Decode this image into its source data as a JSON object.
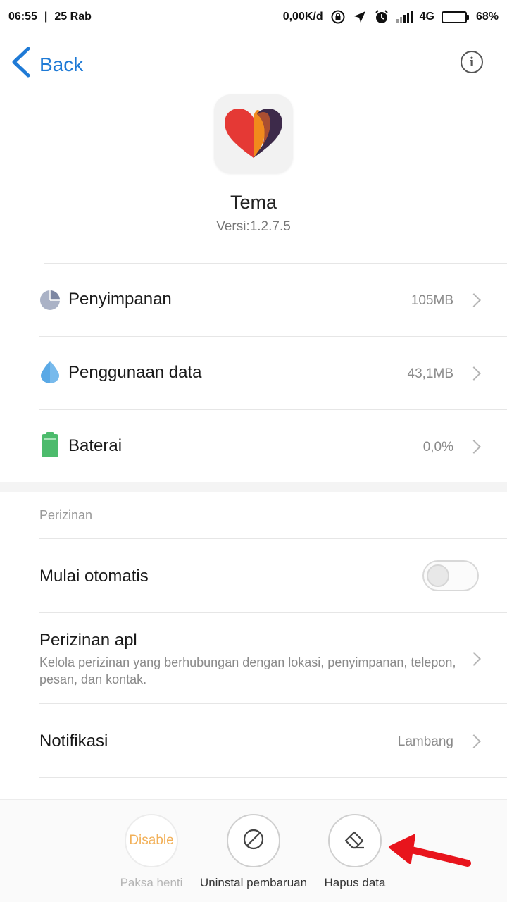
{
  "status_bar": {
    "time": "06:55",
    "separator": "|",
    "date": "25 Rab",
    "net_speed": "0,00K/d",
    "network_type": "4G",
    "battery_percent": "68%",
    "battery_level": 0.68,
    "icons": [
      "rotation-lock-icon",
      "location-arrow-icon",
      "alarm-clock-icon",
      "signal-icon",
      "battery-icon"
    ]
  },
  "nav": {
    "back_label": "Back",
    "info_glyph": "i"
  },
  "app": {
    "name": "Tema",
    "version": "Versi:1.2.7.5",
    "icon": "heart-themes-icon"
  },
  "rows": [
    {
      "label": "Penyimpanan",
      "value": "105MB",
      "icon": "pie-chart-icon",
      "color": "#8f99b3"
    },
    {
      "label": "Penggunaan data",
      "value": "43,1MB",
      "icon": "water-drop-icon",
      "color": "#5aa9e6"
    },
    {
      "label": "Baterai",
      "value": "0,0%",
      "icon": "battery-green-icon",
      "color": "#4cbb6c"
    }
  ],
  "permissions": {
    "section_label": "Perizinan",
    "autostart_label": "Mulai otomatis",
    "autostart_enabled": false,
    "app_perms_label": "Perizinan apl",
    "app_perms_desc": "Kelola perizinan yang berhubungan dengan lokasi, penyimpanan, telepon, pesan, dan kontak.",
    "notif_label": "Notifikasi",
    "notif_value": "Lambang"
  },
  "actions": [
    {
      "label": "Paksa henti",
      "button_text": "Disable",
      "enabled": false
    },
    {
      "label": "Uninstal pembaruan",
      "icon": "prohibited-icon",
      "enabled": true
    },
    {
      "label": "Hapus data",
      "icon": "eraser-icon",
      "enabled": true
    }
  ],
  "colors": {
    "accent": "#1e7ad6",
    "disable_text": "#f0a33c",
    "annotation_arrow": "#e8141c"
  }
}
